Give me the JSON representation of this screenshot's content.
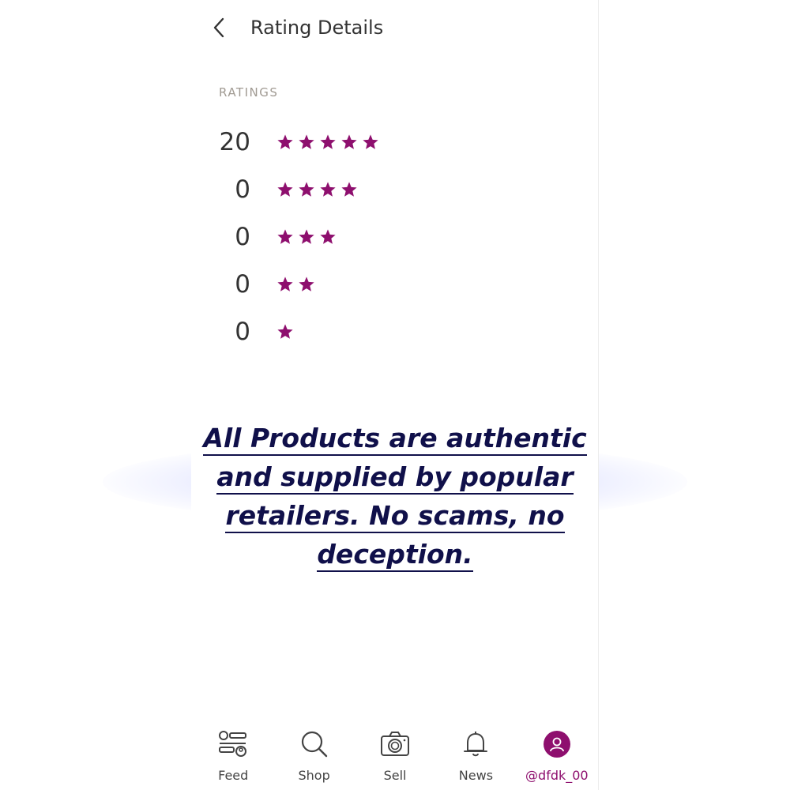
{
  "header": {
    "title": "Rating Details"
  },
  "ratings": {
    "section_label": "RATINGS",
    "rows": [
      {
        "count": "20",
        "stars": 5
      },
      {
        "count": "0",
        "stars": 4
      },
      {
        "count": "0",
        "stars": 3
      },
      {
        "count": "0",
        "stars": 2
      },
      {
        "count": "0",
        "stars": 1
      }
    ]
  },
  "overlay": {
    "lines": [
      "All Products are authentic",
      "and supplied by popular",
      "retailers. No scams, no",
      "deception."
    ]
  },
  "nav": {
    "items": [
      {
        "label": "Feed",
        "icon": "feed-icon"
      },
      {
        "label": "Shop",
        "icon": "search-icon"
      },
      {
        "label": "Sell",
        "icon": "camera-icon"
      },
      {
        "label": "News",
        "icon": "bell-icon"
      },
      {
        "label": "@dfdk_00",
        "icon": "profile-icon"
      }
    ]
  },
  "colors": {
    "accent": "#8e0f6e",
    "text": "#333333",
    "muted": "#a09a92",
    "overlay_text": "#10104a"
  }
}
